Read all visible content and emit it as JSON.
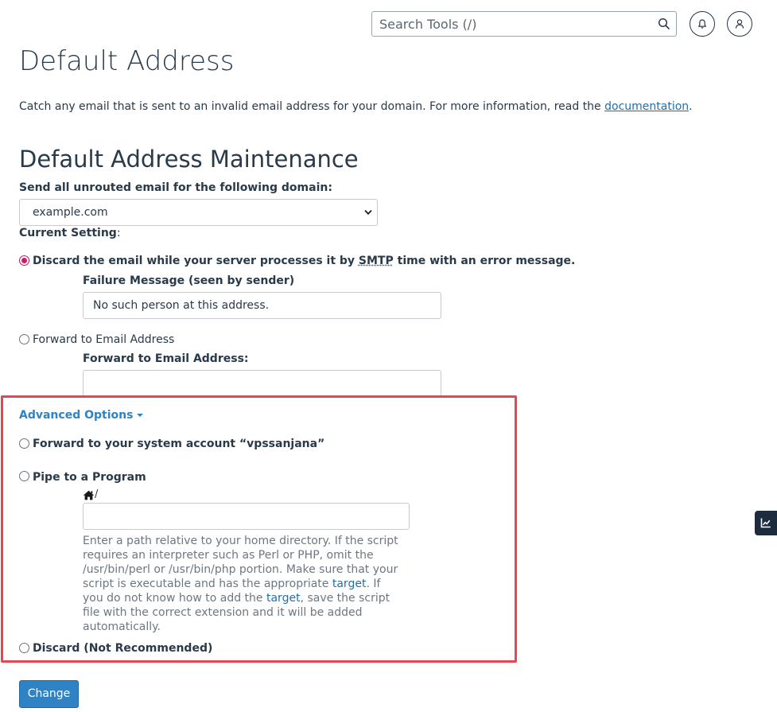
{
  "search": {
    "placeholder": "Search Tools (/)"
  },
  "page": {
    "title": "Default Address",
    "description_prefix": "Catch any email that is sent to an invalid email address for your domain. For more information, read the ",
    "documentation_link": "documentation",
    "description_suffix": "."
  },
  "section": {
    "title": "Default Address Maintenance",
    "domain_label": "Send all unrouted email for the following domain:",
    "domain_selected": "example.com",
    "current_setting_label": "Current Setting",
    "current_setting_colon": ":"
  },
  "options": {
    "discard_with_error": {
      "label_prefix": "Discard the email while your server processes it by ",
      "label_abbr": "SMTP",
      "label_suffix": " time with an error message.",
      "failure_label": "Failure Message (seen by sender)",
      "failure_value": "No such person at this address."
    },
    "forward_email": {
      "label": "Forward to Email Address",
      "field_label": "Forward to Email Address:",
      "field_value": ""
    },
    "advanced_label": "Advanced Options",
    "forward_system": {
      "label": "Forward to your system account “vpssanjana”"
    },
    "pipe_program": {
      "label": "Pipe to a Program",
      "home_path": "/",
      "field_value": "",
      "help_1": "Enter a path relative to your home directory. If the script requires an interpreter such as Perl or PHP, omit the /usr/bin/perl or /usr/bin/php portion. Make sure that your script is executable and has the appropriate ",
      "help_link_1": "target",
      "help_2": ". If you do not know how to add the ",
      "help_link_2": "target",
      "help_3": ", save the script file with the correct extension and it will be added automatically."
    },
    "discard_not_recommended": {
      "label": "Discard (Not Recommended)"
    }
  },
  "buttons": {
    "change": "Change"
  },
  "colors": {
    "accent": "#2f82c4",
    "radio_selected": "#d6176d",
    "highlight": "#e64552",
    "text": "#293a4a"
  },
  "icons": {
    "search": "search-icon",
    "notifications": "bell-icon",
    "user": "user-icon",
    "home": "home-icon",
    "stats": "chart-line-icon"
  }
}
